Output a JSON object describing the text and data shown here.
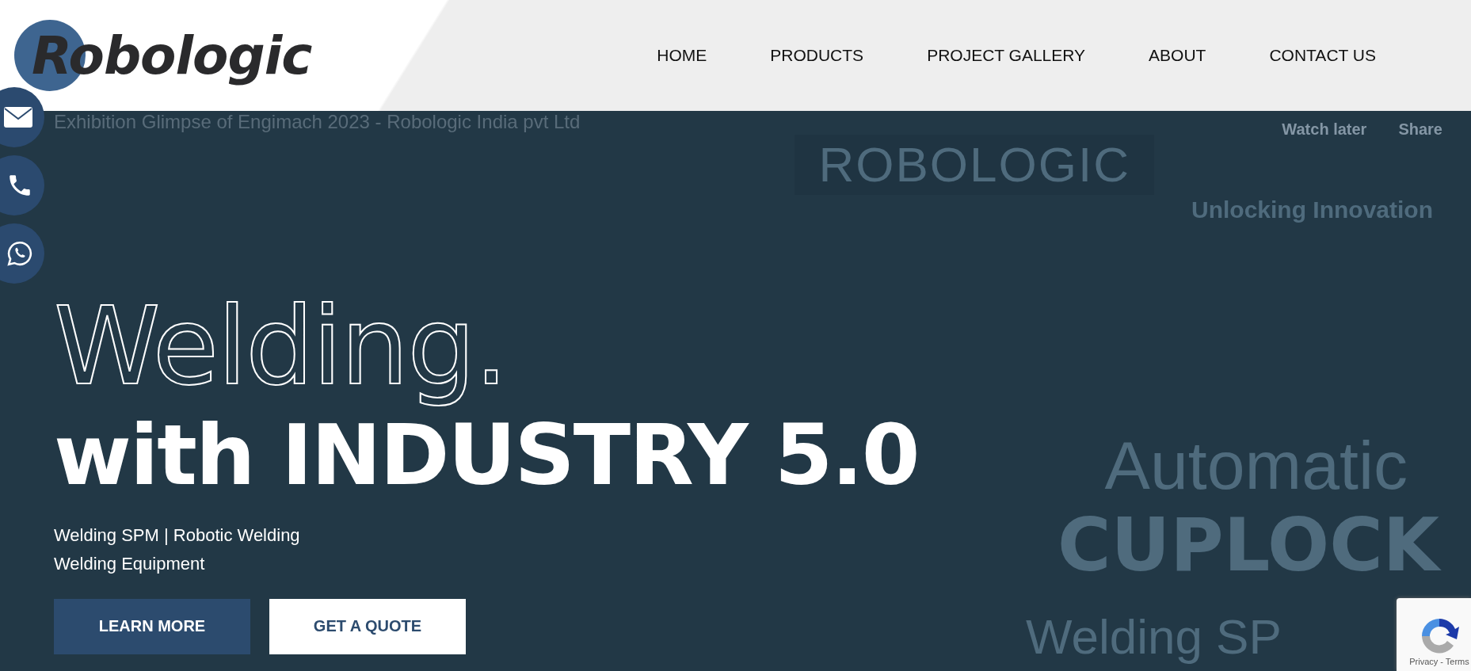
{
  "header": {
    "logo": "Robologic",
    "nav": [
      {
        "label": "HOME"
      },
      {
        "label": "PRODUCTS"
      },
      {
        "label": "PROJECT GALLERY"
      },
      {
        "label": "ABOUT"
      },
      {
        "label": "CONTACT US"
      }
    ]
  },
  "video": {
    "title": "Exhibition Glimpse of Engimach 2023 - Robologic India pvt Ltd",
    "actions": [
      "Watch later",
      "Share"
    ],
    "frame_texts": [
      "ROBOLOGIC",
      "Unlocking Innovation",
      "Automatic",
      "CUPLOCK",
      "Welding SP"
    ]
  },
  "side_contacts": [
    {
      "kind": "mail"
    },
    {
      "kind": "phone"
    },
    {
      "kind": "whatsapp"
    }
  ],
  "hero": {
    "outline_title": "Welding.",
    "title": "with INDUSTRY 5.0",
    "subtitle_lines": [
      "Welding SPM | Robotic Welding",
      "Welding Equipment"
    ],
    "buttons": [
      {
        "label": "LEARN MORE",
        "kind": "primary"
      },
      {
        "label": "GET A QUOTE",
        "kind": "secondary"
      }
    ]
  },
  "recaptcha": {
    "links": "Privacy - Terms"
  }
}
